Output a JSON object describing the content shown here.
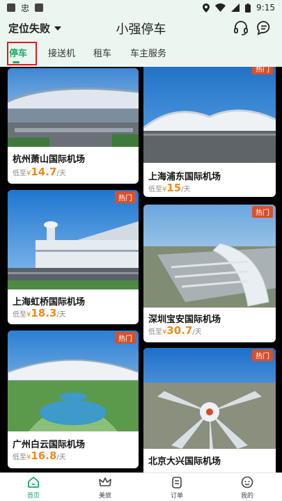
{
  "status_bar": {
    "carrier_glyph": "忠",
    "time": "9:15"
  },
  "header": {
    "location_label": "定位失败",
    "title": "小强停车"
  },
  "tabs": [
    {
      "label": "停车",
      "active": true
    },
    {
      "label": "接送机",
      "active": false
    },
    {
      "label": "租车",
      "active": false
    },
    {
      "label": "车主服务",
      "active": false
    }
  ],
  "cards": [
    {
      "name": "杭州萧山国际机场",
      "price_prefix": "低至",
      "currency": "¥",
      "price": "14.7",
      "unit": "/天",
      "hot": false
    },
    {
      "name": "上海浦东国际机场",
      "price_prefix": "低至",
      "currency": "¥",
      "price": "15",
      "unit": "/天",
      "hot": true,
      "hot_label": "热门"
    },
    {
      "name": "上海虹桥国际机场",
      "price_prefix": "低至",
      "currency": "¥",
      "price": "18.3",
      "unit": "/天",
      "hot": true,
      "hot_label": "热门"
    },
    {
      "name": "深圳宝安国际机场",
      "price_prefix": "低至",
      "currency": "¥",
      "price": "30.7",
      "unit": "/天",
      "hot": true,
      "hot_label": "热门"
    },
    {
      "name": "广州白云国际机场",
      "price_prefix": "低至",
      "currency": "¥",
      "price": "16.8",
      "unit": "/天",
      "hot": true,
      "hot_label": "热门"
    },
    {
      "name": "北京大兴国际机场",
      "price_prefix": "",
      "currency": "",
      "price": "",
      "unit": "",
      "hot": true,
      "hot_label": "热门"
    }
  ],
  "bottom_nav": [
    {
      "label": "首页",
      "icon": "home-icon",
      "active": true
    },
    {
      "label": "美旅",
      "icon": "crown-icon",
      "active": false
    },
    {
      "label": "订单",
      "icon": "order-icon",
      "active": false
    },
    {
      "label": "我的",
      "icon": "profile-icon",
      "active": false
    }
  ],
  "colors": {
    "accent": "#1aa86a",
    "price": "#f08a1b",
    "hot_badge": "#d6512d",
    "header_bg": "#ecf6f0",
    "highlight_box": "#e0191e"
  }
}
